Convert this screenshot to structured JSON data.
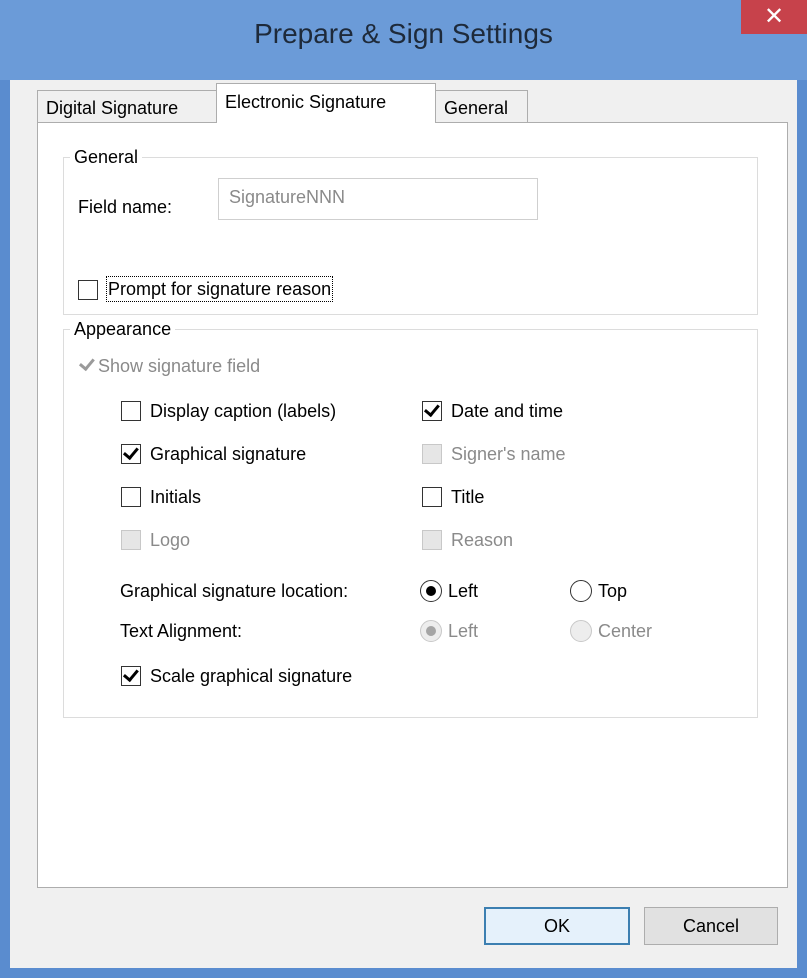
{
  "window": {
    "title": "Prepare & Sign Settings",
    "close_glyph": "✕"
  },
  "tabs": [
    {
      "label": "Digital Signature",
      "active": false
    },
    {
      "label": "Electronic Signature",
      "active": true
    },
    {
      "label": "General",
      "active": false
    }
  ],
  "general_group": {
    "legend": "General",
    "field_name_label": "Field name:",
    "field_name_placeholder": "SignatureNNN",
    "prompt_reason": {
      "label": "Prompt for signature reason",
      "checked": false,
      "enabled": true
    }
  },
  "appearance_group": {
    "legend": "Appearance",
    "show_signature_field": {
      "label": "Show signature field",
      "checked": true,
      "enabled": false
    },
    "options": {
      "display_caption": {
        "label": "Display caption (labels)",
        "checked": false,
        "enabled": true
      },
      "date_time": {
        "label": "Date and time",
        "checked": true,
        "enabled": true
      },
      "graphical_signature": {
        "label": "Graphical signature",
        "checked": true,
        "enabled": true
      },
      "signers_name": {
        "label": "Signer's name",
        "checked": false,
        "enabled": false
      },
      "initials": {
        "label": "Initials",
        "checked": false,
        "enabled": true
      },
      "title": {
        "label": "Title",
        "checked": false,
        "enabled": true
      },
      "logo": {
        "label": "Logo",
        "checked": false,
        "enabled": false
      },
      "reason": {
        "label": "Reason",
        "checked": false,
        "enabled": false
      }
    },
    "location": {
      "label": "Graphical signature location:",
      "left": {
        "label": "Left",
        "selected": true,
        "enabled": true
      },
      "top": {
        "label": "Top",
        "selected": false,
        "enabled": true
      }
    },
    "alignment": {
      "label": "Text Alignment:",
      "left": {
        "label": "Left",
        "selected": true,
        "enabled": false
      },
      "center": {
        "label": "Center",
        "selected": false,
        "enabled": false
      }
    },
    "scale_graphical": {
      "label": "Scale graphical signature",
      "checked": true,
      "enabled": true
    }
  },
  "buttons": {
    "ok": "OK",
    "cancel": "Cancel"
  },
  "colors": {
    "titlebar": "#6b9bd8",
    "close_button": "#c7424b",
    "default_button_border": "#3c7fb1"
  }
}
